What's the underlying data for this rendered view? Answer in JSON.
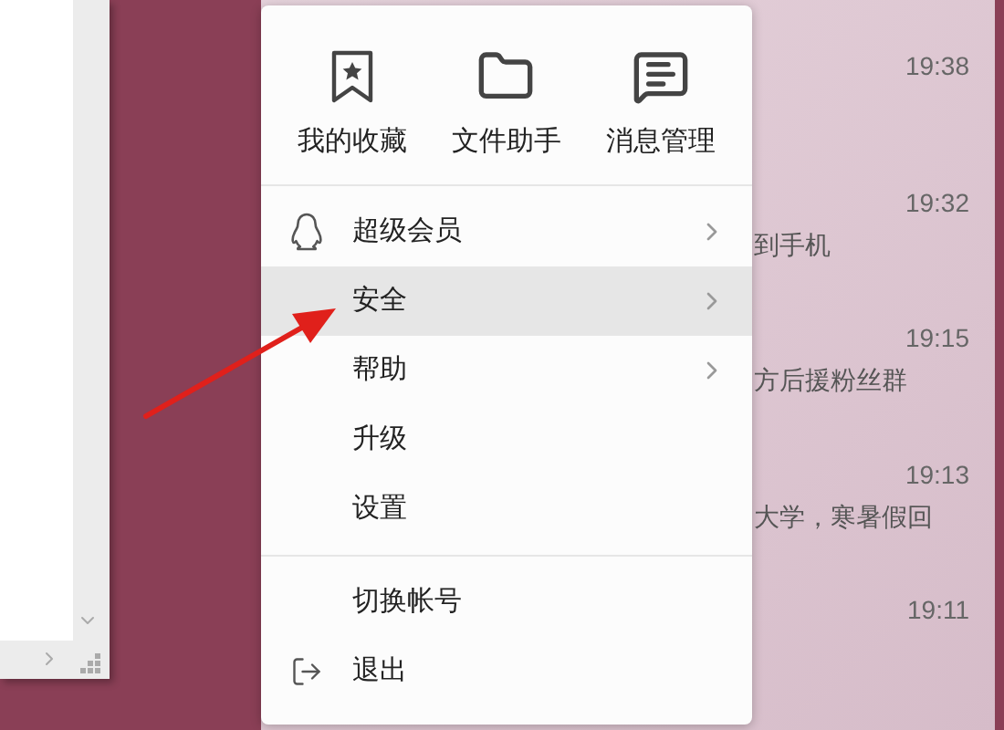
{
  "menu": {
    "shortcuts": [
      {
        "label": "我的收藏"
      },
      {
        "label": "文件助手"
      },
      {
        "label": "消息管理"
      }
    ],
    "groups": [
      {
        "items": [
          {
            "label": "超级会员",
            "selected": false,
            "has_submenu": true
          },
          {
            "label": "安全",
            "selected": true,
            "has_submenu": true
          },
          {
            "label": "帮助",
            "selected": false,
            "has_submenu": true
          },
          {
            "label": "升级",
            "selected": false,
            "has_submenu": false
          },
          {
            "label": "设置",
            "selected": false,
            "has_submenu": false
          }
        ]
      },
      {
        "items": [
          {
            "label": "切换帐号",
            "selected": false,
            "has_submenu": false
          },
          {
            "label": "退出",
            "selected": false,
            "has_submenu": false
          }
        ]
      }
    ]
  },
  "chats": [
    {
      "time": "19:38"
    },
    {
      "time": "19:32",
      "preview": "到手机"
    },
    {
      "time": "19:15",
      "preview": "方后援粉丝群"
    },
    {
      "time": "19:13",
      "preview": "大学，寒暑假回"
    },
    {
      "time": "19:11"
    }
  ]
}
